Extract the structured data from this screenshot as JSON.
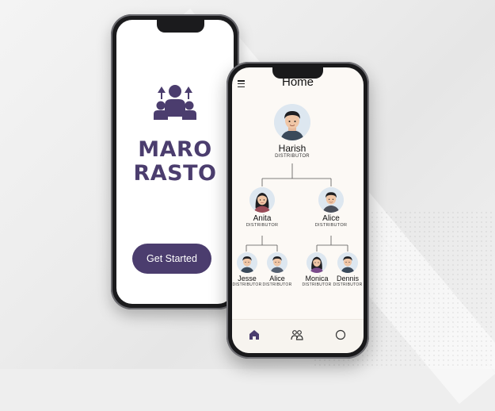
{
  "onboarding": {
    "brand_line1": "MARO",
    "brand_line2": "RASTO",
    "cta_label": "Get Started",
    "logo_icon": "team-growth-icon"
  },
  "home": {
    "title": "Home",
    "menu_icon": "hamburger-menu-icon",
    "tree": {
      "root": {
        "name": "Harish",
        "role": "DISTRIBUTOR"
      },
      "level2": [
        {
          "name": "Anita",
          "role": "DISTRIBUTOR"
        },
        {
          "name": "Alice",
          "role": "DISTRIBUTOR"
        }
      ],
      "level3": [
        {
          "name": "Jesse",
          "role": "DISTRIBUTOR"
        },
        {
          "name": "Alice",
          "role": "DISTRIBUTOR"
        },
        {
          "name": "Monica",
          "role": "DISTRIBUTOR"
        },
        {
          "name": "Dennis",
          "role": "DISTRIBUTOR"
        }
      ]
    },
    "nav": [
      "home-icon",
      "people-icon",
      "profile-circle-icon"
    ]
  },
  "colors": {
    "brand": "#4b3d6e",
    "screen_bg": "#fcf9f5",
    "avatar_bg": "#dde7f0"
  }
}
